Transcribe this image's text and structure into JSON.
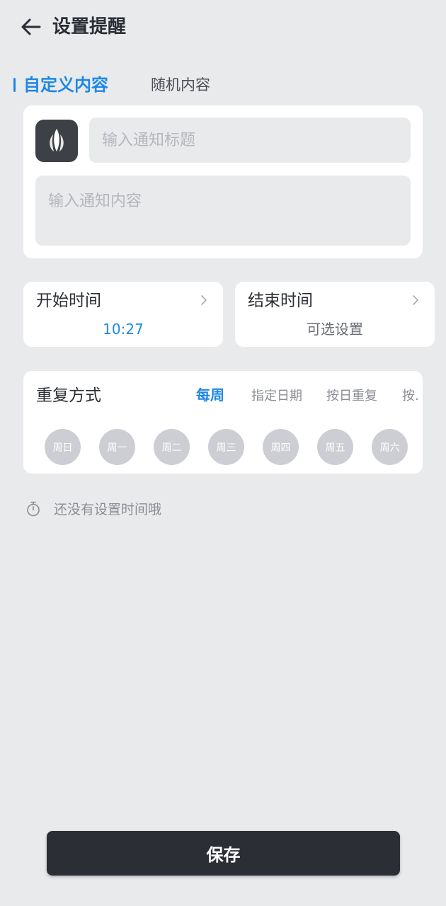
{
  "header": {
    "title": "设置提醒"
  },
  "tabs": {
    "active": "自定义内容",
    "inactive": "随机内容"
  },
  "content_card": {
    "title_placeholder": "输入通知标题",
    "content_placeholder": "输入通知内容"
  },
  "time": {
    "start_label": "开始时间",
    "start_value": "10:27",
    "end_label": "结束时间",
    "end_value": "可选设置"
  },
  "repeat": {
    "label": "重复方式",
    "modes": [
      "每周",
      "指定日期",
      "按日重复",
      "按."
    ],
    "days": [
      "周日",
      "周一",
      "周二",
      "周三",
      "周四",
      "周五",
      "周六"
    ]
  },
  "hint": {
    "text": "还没有设置时间哦"
  },
  "save_label": "保存",
  "colors": {
    "accent": "#1e88e5",
    "background": "#e9eaec",
    "dark": "#2b2e35"
  }
}
